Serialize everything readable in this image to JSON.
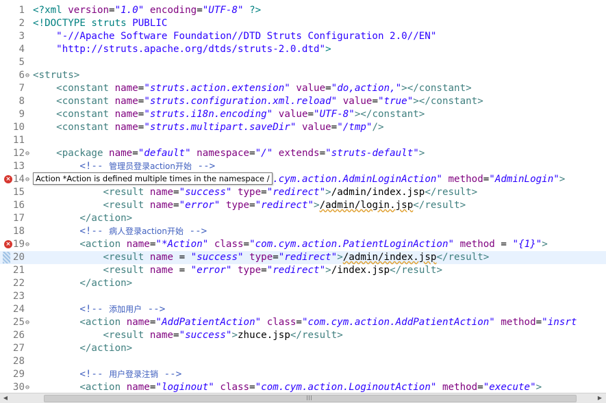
{
  "editor": {
    "lines": [
      {
        "n": "1",
        "parts": [
          [
            "decl",
            "<?xml "
          ],
          [
            "attr",
            "version"
          ],
          [
            "",
            "="
          ],
          [
            "val",
            "\"1.0\""
          ],
          [
            "attr",
            " encoding"
          ],
          [
            "",
            "="
          ],
          [
            "val",
            "\"UTF-8\""
          ],
          [
            "decl",
            " ?>"
          ]
        ]
      },
      {
        "n": "2",
        "parts": [
          [
            "decl",
            "<!DOCTYPE struts "
          ],
          [
            "plain",
            "PUBLIC"
          ]
        ]
      },
      {
        "n": "3",
        "parts": [
          [
            "",
            "    "
          ],
          [
            "plain",
            "\"-//Apache Software Foundation//DTD Struts Configuration 2.0//EN\""
          ]
        ]
      },
      {
        "n": "4",
        "parts": [
          [
            "",
            "    "
          ],
          [
            "plain",
            "\"http://struts.apache.org/dtds/struts-2.0.dtd\""
          ],
          [
            "decl",
            ">"
          ]
        ]
      },
      {
        "n": "5",
        "parts": []
      },
      {
        "n": "6",
        "fold": "⊖",
        "parts": [
          [
            "tag",
            "<struts>"
          ]
        ]
      },
      {
        "n": "7",
        "parts": [
          [
            "",
            "    "
          ],
          [
            "tag",
            "<constant "
          ],
          [
            "attr",
            "name"
          ],
          [
            "",
            "="
          ],
          [
            "val",
            "\"struts.action.extension\""
          ],
          [
            "attr",
            " value"
          ],
          [
            "",
            "="
          ],
          [
            "val",
            "\"do,action,\""
          ],
          [
            "tag",
            "></constant>"
          ]
        ]
      },
      {
        "n": "8",
        "parts": [
          [
            "",
            "    "
          ],
          [
            "tag",
            "<constant "
          ],
          [
            "attr",
            "name"
          ],
          [
            "",
            "="
          ],
          [
            "val",
            "\"struts.configuration.xml.reload\""
          ],
          [
            "attr",
            " value"
          ],
          [
            "",
            "="
          ],
          [
            "val",
            "\"true\""
          ],
          [
            "tag",
            "></constant>"
          ]
        ]
      },
      {
        "n": "9",
        "parts": [
          [
            "",
            "    "
          ],
          [
            "tag",
            "<constant "
          ],
          [
            "attr",
            "name"
          ],
          [
            "",
            "="
          ],
          [
            "val",
            "\"struts.i18n.encoding\""
          ],
          [
            "attr",
            " value"
          ],
          [
            "",
            "="
          ],
          [
            "val",
            "\"UTF-8\""
          ],
          [
            "tag",
            "></constant>"
          ]
        ]
      },
      {
        "n": "10",
        "parts": [
          [
            "",
            "    "
          ],
          [
            "tag",
            "<constant "
          ],
          [
            "attr",
            "name"
          ],
          [
            "",
            "="
          ],
          [
            "val",
            "\"struts.multipart.saveDir\""
          ],
          [
            "attr",
            " value"
          ],
          [
            "",
            "="
          ],
          [
            "val",
            "\"/tmp\""
          ],
          [
            "tag",
            "/>"
          ]
        ]
      },
      {
        "n": "11",
        "parts": []
      },
      {
        "n": "12",
        "fold": "⊖",
        "parts": [
          [
            "",
            "    "
          ],
          [
            "tag",
            "<package "
          ],
          [
            "attr",
            "name"
          ],
          [
            "",
            "="
          ],
          [
            "val",
            "\"default\""
          ],
          [
            "attr",
            " namespace"
          ],
          [
            "",
            "="
          ],
          [
            "val",
            "\"/\""
          ],
          [
            "attr",
            " extends"
          ],
          [
            "",
            "="
          ],
          [
            "val",
            "\"struts-default\""
          ],
          [
            "tag",
            ">"
          ]
        ]
      },
      {
        "n": "13",
        "parts": [
          [
            "",
            "        "
          ],
          [
            "cm",
            "<!-- "
          ],
          [
            "cmtext",
            "管理员登录action开始"
          ],
          [
            "cm",
            " -->"
          ]
        ]
      },
      {
        "n": "14",
        "err": true,
        "fold": "⊖",
        "parts": [
          [
            "",
            "        "
          ],
          [
            "tag",
            "<action "
          ],
          [
            "attr",
            "name"
          ],
          [
            "",
            "="
          ],
          [
            "val",
            "\"*Action\""
          ],
          [
            "attr",
            " class"
          ],
          [
            "",
            "="
          ],
          [
            "val",
            "\"com.cym.action.AdminLoginAction\""
          ],
          [
            "attr",
            " method"
          ],
          [
            "",
            "="
          ],
          [
            "val",
            "\"AdminLogin\""
          ],
          [
            "tag",
            ">"
          ]
        ]
      },
      {
        "n": "15",
        "parts": [
          [
            "",
            "            "
          ],
          [
            "tag",
            "<result "
          ],
          [
            "attr",
            "name"
          ],
          [
            "",
            "="
          ],
          [
            "val",
            "\"success\""
          ],
          [
            "attr",
            " type"
          ],
          [
            "",
            "="
          ],
          [
            "val",
            "\"redirect\""
          ],
          [
            "tag",
            ">"
          ],
          [
            "",
            "/admin/index.jsp"
          ],
          [
            "tag",
            "</result>"
          ]
        ]
      },
      {
        "n": "16",
        "parts": [
          [
            "",
            "            "
          ],
          [
            "tag",
            "<result "
          ],
          [
            "attr",
            "name"
          ],
          [
            "",
            "="
          ],
          [
            "val",
            "\"error\""
          ],
          [
            "attr",
            " type"
          ],
          [
            "",
            "="
          ],
          [
            "val",
            "\"redirect\""
          ],
          [
            "tag",
            ">"
          ],
          [
            "",
            "/admin/login.jsp"
          ],
          [
            "tag",
            "</result>"
          ]
        ]
      },
      {
        "n": "17",
        "parts": [
          [
            "",
            "        "
          ],
          [
            "tag",
            "</action>"
          ]
        ]
      },
      {
        "n": "18",
        "parts": [
          [
            "",
            "        "
          ],
          [
            "cm",
            "<!-- "
          ],
          [
            "cmtext",
            "病人登录action开始"
          ],
          [
            "cm",
            " -->"
          ]
        ]
      },
      {
        "n": "19",
        "err": true,
        "fold": "⊖",
        "parts": [
          [
            "",
            "        "
          ],
          [
            "tag",
            "<action "
          ],
          [
            "attr",
            "name"
          ],
          [
            "",
            "="
          ],
          [
            "val",
            "\"*Action\""
          ],
          [
            "attr",
            " class"
          ],
          [
            "",
            "="
          ],
          [
            "val",
            "\"com.cym.action.PatientLoginAction\""
          ],
          [
            "attr",
            " method "
          ],
          [
            "",
            "= "
          ],
          [
            "val",
            "\"{1}\""
          ],
          [
            "tag",
            ">"
          ]
        ]
      },
      {
        "n": "20",
        "current": true,
        "bookmark": true,
        "parts": [
          [
            "",
            "            "
          ],
          [
            "tag",
            "<result "
          ],
          [
            "attr",
            "name "
          ],
          [
            "",
            "= "
          ],
          [
            "val",
            "\"success\""
          ],
          [
            "attr",
            " type"
          ],
          [
            "",
            "="
          ],
          [
            "val",
            "\"redirect\""
          ],
          [
            "tag",
            ">"
          ],
          [
            "",
            "/admin/index.jsp"
          ],
          [
            "tag",
            "</result>"
          ]
        ]
      },
      {
        "n": "21",
        "parts": [
          [
            "",
            "            "
          ],
          [
            "tag",
            "<result "
          ],
          [
            "attr",
            "name "
          ],
          [
            "",
            "= "
          ],
          [
            "val",
            "\"error\""
          ],
          [
            "attr",
            " type"
          ],
          [
            "",
            "="
          ],
          [
            "val",
            "\"redirect\""
          ],
          [
            "tag",
            ">"
          ],
          [
            "",
            "/index.jsp"
          ],
          [
            "tag",
            "</result>"
          ]
        ]
      },
      {
        "n": "22",
        "parts": [
          [
            "",
            "        "
          ],
          [
            "tag",
            "</action>"
          ]
        ]
      },
      {
        "n": "23",
        "parts": []
      },
      {
        "n": "24",
        "parts": [
          [
            "",
            "        "
          ],
          [
            "cm",
            "<!-- "
          ],
          [
            "cmtext",
            "添加用户"
          ],
          [
            "cm",
            " -->"
          ]
        ]
      },
      {
        "n": "25",
        "fold": "⊖",
        "parts": [
          [
            "",
            "        "
          ],
          [
            "tag",
            "<action "
          ],
          [
            "attr",
            "name"
          ],
          [
            "",
            "="
          ],
          [
            "val",
            "\"AddPatientAction\""
          ],
          [
            "attr",
            " class"
          ],
          [
            "",
            "="
          ],
          [
            "val",
            "\"com.cym.action.AddPatientAction\""
          ],
          [
            "attr",
            " method"
          ],
          [
            "",
            "="
          ],
          [
            "val",
            "\"insrt"
          ]
        ]
      },
      {
        "n": "26",
        "parts": [
          [
            "",
            "            "
          ],
          [
            "tag",
            "<result "
          ],
          [
            "attr",
            "name"
          ],
          [
            "",
            "="
          ],
          [
            "val",
            "\"success\""
          ],
          [
            "tag",
            ">"
          ],
          [
            "",
            "zhuce.jsp"
          ],
          [
            "tag",
            "</result>"
          ]
        ]
      },
      {
        "n": "27",
        "parts": [
          [
            "",
            "        "
          ],
          [
            "tag",
            "</action>"
          ]
        ]
      },
      {
        "n": "28",
        "parts": []
      },
      {
        "n": "29",
        "parts": [
          [
            "",
            "        "
          ],
          [
            "cm",
            "<!-- "
          ],
          [
            "cmtext",
            "用户登录注销"
          ],
          [
            "cm",
            " -->"
          ]
        ]
      },
      {
        "n": "30",
        "fold": "⊖",
        "parts": [
          [
            "",
            "        "
          ],
          [
            "tag",
            "<action "
          ],
          [
            "attr",
            "name"
          ],
          [
            "",
            "="
          ],
          [
            "val",
            "\"loginout\""
          ],
          [
            "attr",
            " class"
          ],
          [
            "",
            "="
          ],
          [
            "val",
            "\"com.cym.action.LoginoutAction\""
          ],
          [
            "attr",
            " method"
          ],
          [
            "",
            "="
          ],
          [
            "val",
            "\"execute\""
          ],
          [
            "tag",
            ">"
          ]
        ]
      }
    ],
    "tooltip": "Action *Action is defined multiple times in the namespace /",
    "error_icon": "error-x-icon",
    "fold_icon": "collapse-icon",
    "colors": {
      "tag": "#3f7f7f",
      "attr": "#7f007f",
      "value": "#2a00ff",
      "comment": "#3f5fbf",
      "line_number": "#787878",
      "error": "#d6372f",
      "current_line": "#e8f2fe"
    }
  },
  "scrollbar": {
    "left_arrow": "◀",
    "right_arrow": "▶"
  }
}
